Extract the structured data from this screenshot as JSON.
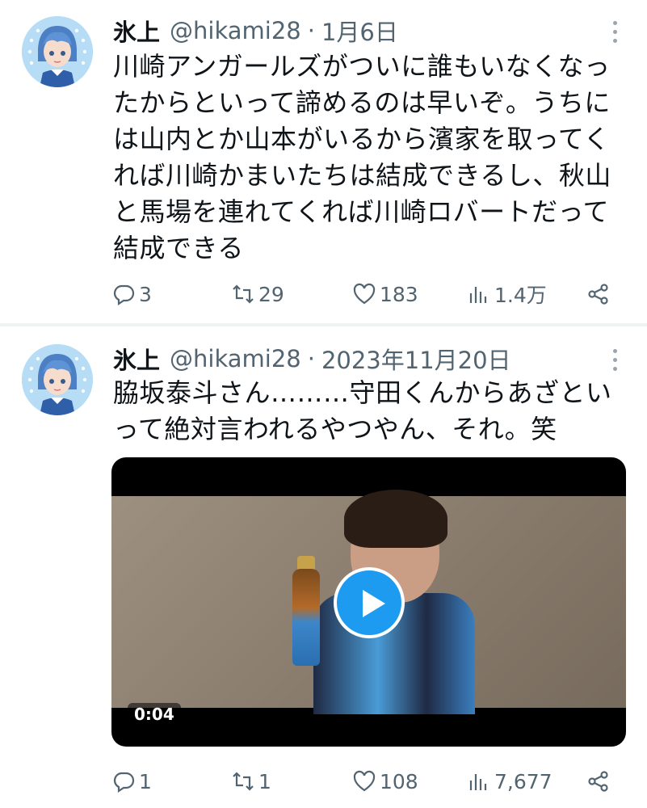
{
  "tweets": [
    {
      "name": "氷上",
      "handle": "@hikami28",
      "separator": "·",
      "date": "1月6日",
      "text": "川崎アンガールズがついに誰もいなくなっ\nたからといって諦めるのは早いぞ。うちに\nは山内とか山本がいるから濱家を取ってく\nれば川崎かまいたちは結成できるし、秋山\nと馬場を連れてくれば川崎ロバートだって\n結成できる",
      "replies": "3",
      "retweets": "29",
      "likes": "183",
      "views": "1.4万"
    },
    {
      "name": "氷上",
      "handle": "@hikami28",
      "separator": "·",
      "date": "2023年11月20日",
      "text": "脇坂泰斗さん………守田くんからあざとい\nって絶対言われるやつやん、それ。笑",
      "video": {
        "duration": "0:04"
      },
      "replies": "1",
      "retweets": "1",
      "likes": "108",
      "views": "7,677"
    }
  ],
  "colors": {
    "accent": "#1d9bf0",
    "secondary_text": "#536471",
    "text": "#0f1419"
  }
}
